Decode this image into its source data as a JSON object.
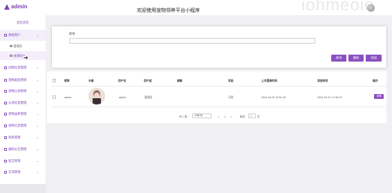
{
  "app": {
    "logo_text": "admin",
    "site_title": "欢迎使用宠物领养平台小程序",
    "watermark": "iohmeoie"
  },
  "sidebar": {
    "home": "后台首页",
    "items": [
      {
        "label": "系统用户",
        "expanded": true
      },
      {
        "label": "动物信息管理"
      },
      {
        "label": "宠物类型管理"
      },
      {
        "label": "宠物认领管理"
      },
      {
        "label": "认领信息管理"
      },
      {
        "label": "宠物送养管理"
      },
      {
        "label": "领养信息管理"
      },
      {
        "label": "系统管理"
      },
      {
        "label": "通知公告管理"
      },
      {
        "label": "留言管理"
      },
      {
        "label": "交流管理"
      }
    ],
    "subitems": [
      {
        "label": "管理员"
      },
      {
        "label": "普通用户"
      }
    ]
  },
  "search": {
    "label": "昵称",
    "value": "",
    "placeholder": ""
  },
  "buttons": {
    "query": "查询",
    "delete": "删除",
    "add": "添加"
  },
  "table": {
    "columns": [
      "昵称",
      "头像",
      "用户名",
      "用户组",
      "邮箱",
      "状态",
      "上次登录时间",
      "添加时间",
      "操作"
    ],
    "rows": [
      {
        "nickname": "admin",
        "username": "admin",
        "group": "管理员",
        "email": "",
        "status": "可用",
        "last_login": "2024-04-02 22:51:18",
        "created": "2024-03-31 17:30:13",
        "action": "详情"
      }
    ]
  },
  "pagination": {
    "total": "共 1 条",
    "page_size": "10条/页",
    "prev": "<",
    "current": "1",
    "next": ">",
    "goto_label": "前往",
    "goto_value": "1",
    "page_unit": "页"
  },
  "colors": {
    "accent": "#8a4fc2",
    "brand": "#7b3fb6"
  }
}
